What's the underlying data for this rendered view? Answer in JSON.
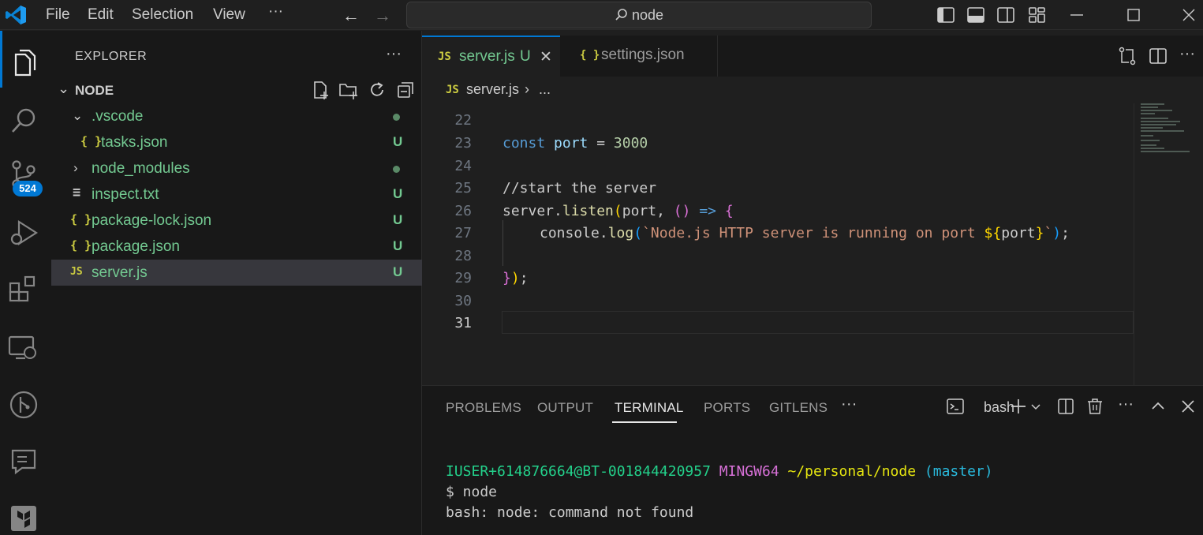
{
  "titlebar": {
    "menu": [
      "File",
      "Edit",
      "Selection",
      "View",
      "···"
    ],
    "search_text": "node"
  },
  "activity": {
    "source_control_badge": "524"
  },
  "sidebar": {
    "title": "EXPLORER",
    "more": "···",
    "folder": "NODE",
    "tree": [
      {
        "name": ".vscode",
        "icon": "",
        "status": "dot"
      },
      {
        "name": "tasks.json",
        "icon": "{ }",
        "status": "U"
      },
      {
        "name": "node_modules",
        "icon": "",
        "status": "dot"
      },
      {
        "name": "inspect.txt",
        "icon": "≡",
        "status": "U"
      },
      {
        "name": "package-lock.json",
        "icon": "{ }",
        "status": "U"
      },
      {
        "name": "package.json",
        "icon": "{ }",
        "status": "U"
      },
      {
        "name": "server.js",
        "icon": "JS",
        "status": "U"
      }
    ]
  },
  "editor": {
    "tabs": [
      {
        "icon": "JS",
        "name": "server.js",
        "status": "U",
        "close": "✕"
      },
      {
        "icon": "{ }",
        "name": "settings.json"
      }
    ],
    "breadcrumb": {
      "icon": "JS",
      "file": "server.js",
      "sep": "›",
      "symbol": "..."
    },
    "line_numbers": [
      "22",
      "23",
      "24",
      "25",
      "26",
      "27",
      "28",
      "29",
      "30",
      "31"
    ],
    "code": {
      "l23": {
        "kw": "const",
        "var": "port",
        "op": " = ",
        "num": "3000"
      },
      "l25": "//start the server",
      "l26": {
        "obj": "server",
        "dot": ".",
        "fn": "listen",
        "p1": "(",
        "arg": "port",
        "comma": ", ",
        "p2": "()",
        "arrow": " => ",
        "brace": "{"
      },
      "l27": {
        "obj": "console",
        "dot": ".",
        "fn": "log",
        "p1": "(",
        "str1": "`Node.js HTTP server is running on port ",
        "tpl_open": "${",
        "tvar": "port",
        "tpl_close": "}",
        "str2": "`",
        "p2": ")",
        "semi": ";"
      },
      "l29": {
        "brace": "}",
        "paren": ")",
        "semi": ";"
      }
    }
  },
  "panel": {
    "tabs": [
      "PROBLEMS",
      "OUTPUT",
      "TERMINAL",
      "PORTS",
      "GITLENS",
      "···"
    ],
    "shell": "bash",
    "terminal": {
      "user": "IUSER+614876664@BT-001844420957",
      "system": "MINGW64",
      "path": "~/personal/node",
      "branch": "(master)",
      "cmd": "$ node",
      "output": "bash: node: command not found"
    }
  }
}
